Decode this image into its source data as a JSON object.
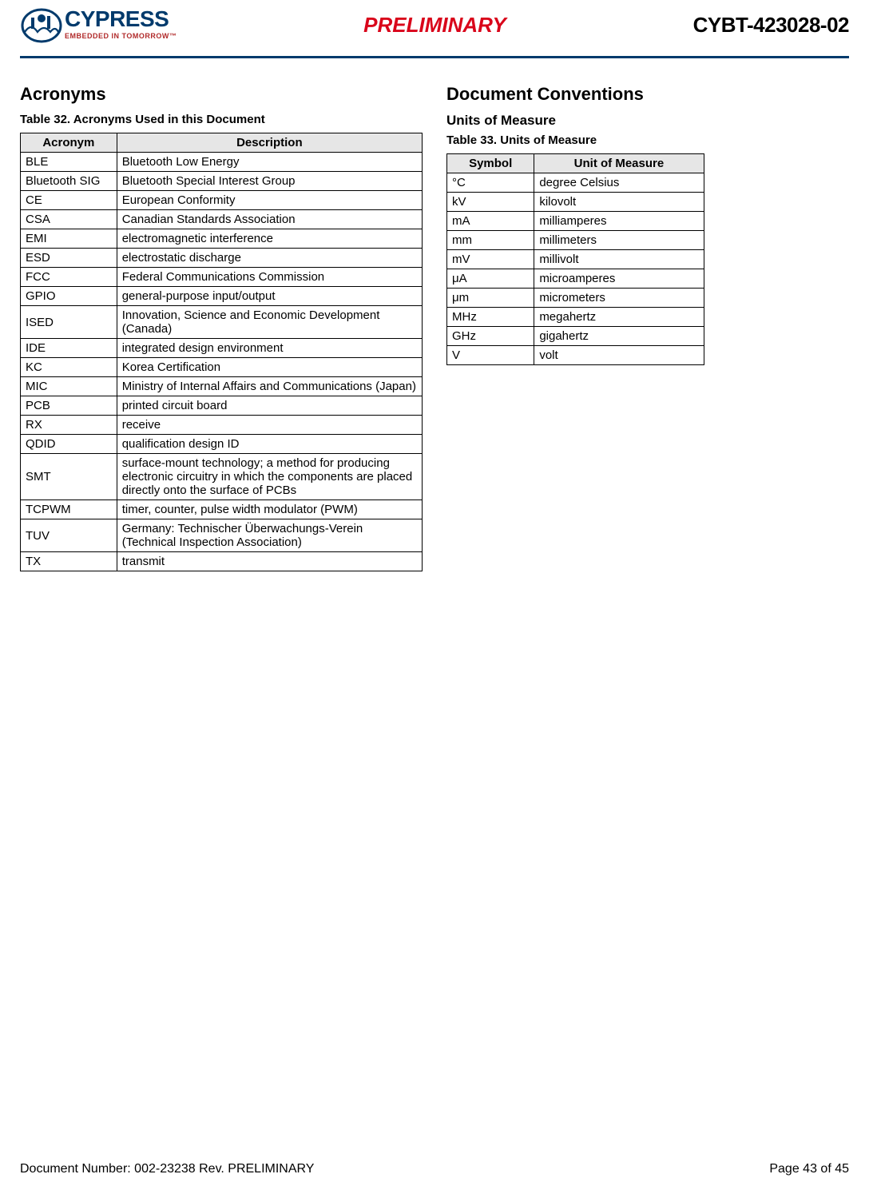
{
  "header": {
    "logo_name": "CYPRESS",
    "logo_tagline": "EMBEDDED IN TOMORROW™",
    "preliminary": "PRELIMINARY",
    "doc_code": "CYBT-423028-02"
  },
  "left": {
    "heading": "Acronyms",
    "table_caption": "Table 32.  Acronyms Used in this Document",
    "th1": "Acronym",
    "th2": "Description",
    "rows": [
      {
        "a": "BLE",
        "d": "Bluetooth Low Energy"
      },
      {
        "a": "Bluetooth SIG",
        "d": "Bluetooth Special Interest Group"
      },
      {
        "a": "CE",
        "d": "European Conformity"
      },
      {
        "a": "CSA",
        "d": "Canadian Standards Association"
      },
      {
        "a": "EMI",
        "d": "electromagnetic interference"
      },
      {
        "a": "ESD",
        "d": "electrostatic discharge"
      },
      {
        "a": "FCC",
        "d": "Federal Communications Commission"
      },
      {
        "a": "GPIO",
        "d": "general-purpose input/output"
      },
      {
        "a": "ISED",
        "d": "Innovation, Science and Economic Development (Canada)"
      },
      {
        "a": "IDE",
        "d": "integrated design environment"
      },
      {
        "a": "KC",
        "d": "Korea Certification"
      },
      {
        "a": "MIC",
        "d": "Ministry of Internal Affairs and Communications (Japan)"
      },
      {
        "a": "PCB",
        "d": "printed circuit board"
      },
      {
        "a": "RX",
        "d": "receive"
      },
      {
        "a": "QDID",
        "d": "qualification design ID"
      },
      {
        "a": "SMT",
        "d": "surface-mount technology; a method for producing electronic circuitry in which the components are placed directly onto the surface of PCBs"
      },
      {
        "a": "TCPWM",
        "d": "timer, counter, pulse width modulator (PWM)"
      },
      {
        "a": "TUV",
        "d": "Germany: Technischer Überwachungs-Verein (Technical Inspection Association)"
      },
      {
        "a": "TX",
        "d": "transmit"
      }
    ]
  },
  "right": {
    "heading": "Document Conventions",
    "subhead": "Units of Measure",
    "table_caption": "Table 33.  Units of Measure",
    "th1": "Symbol",
    "th2": "Unit of Measure",
    "rows": [
      {
        "s": "°C",
        "u": "degree Celsius"
      },
      {
        "s": "kV",
        "u": "kilovolt"
      },
      {
        "s": "mA",
        "u": "milliamperes"
      },
      {
        "s": "mm",
        "u": "millimeters"
      },
      {
        "s": "mV",
        "u": "millivolt"
      },
      {
        "s": "μA",
        "u": "microamperes"
      },
      {
        "s": "μm",
        "u": "micrometers"
      },
      {
        "s": "MHz",
        "u": "megahertz"
      },
      {
        "s": "GHz",
        "u": "gigahertz"
      },
      {
        "s": "V",
        "u": "volt"
      }
    ]
  },
  "footer": {
    "left": "Document Number: 002-23238 Rev. PRELIMINARY",
    "right": "Page 43 of 45"
  }
}
